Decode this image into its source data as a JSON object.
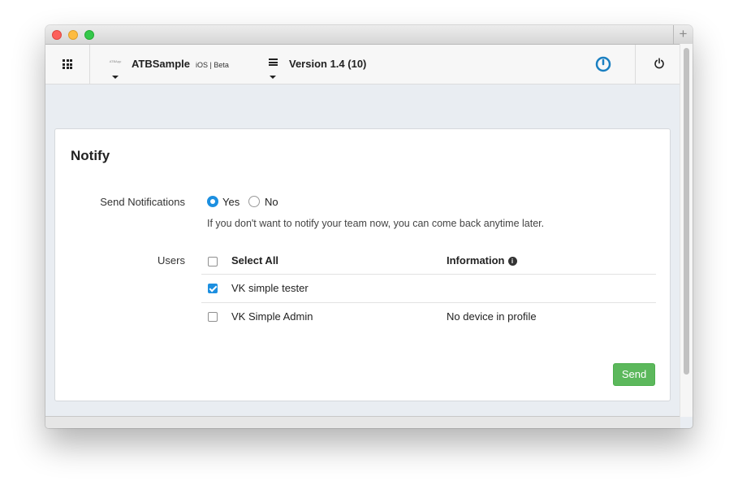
{
  "window": {
    "new_tab_label": "+"
  },
  "nav": {
    "app_logo_text": "ATBApp",
    "app_name": "ATBSample",
    "app_tag": "iOS | Beta",
    "version": "Version 1.4 (10)"
  },
  "notify": {
    "title": "Notify",
    "send_notifications_label": "Send Notifications",
    "yes_label": "Yes",
    "no_label": "No",
    "selected": "Yes",
    "help_text": "If you don't want to notify your team now, you can come back anytime later.",
    "users_label": "Users",
    "select_all_label": "Select All",
    "information_header": "Information",
    "users": [
      {
        "name": "VK simple tester",
        "info": "",
        "checked": true
      },
      {
        "name": "VK Simple Admin",
        "info": "No device in profile",
        "checked": false
      }
    ],
    "send_label": "Send"
  },
  "colors": {
    "accent": "#1c8fe0",
    "send_button": "#5cb85c",
    "power_icon": "#1a7fc1"
  }
}
